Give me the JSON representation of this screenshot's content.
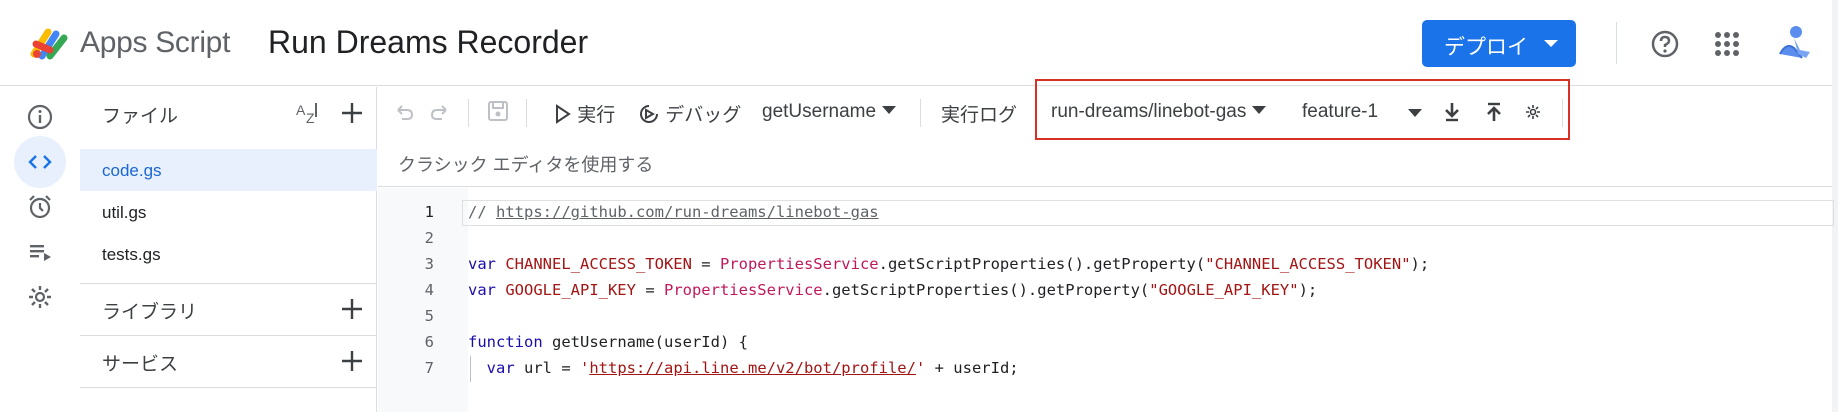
{
  "header": {
    "brand": "Apps Script",
    "project_title": "Run Dreams Recorder",
    "deploy_label": "デプロイ"
  },
  "files_panel": {
    "title": "ファイル",
    "files": [
      {
        "name": "code.gs",
        "selected": true
      },
      {
        "name": "util.gs",
        "selected": false
      },
      {
        "name": "tests.gs",
        "selected": false
      }
    ],
    "libraries_label": "ライブラリ",
    "services_label": "サービス"
  },
  "toolbar": {
    "run_label": "実行",
    "debug_label": "デバッグ",
    "function_select": "getUsername",
    "log_label": "実行ログ",
    "gas_repo": "run-dreams/linebot-gas",
    "gas_branch": "feature-1",
    "classic_editor_link": "クラシック エディタを使用する"
  },
  "editor": {
    "lines": [
      {
        "num": "1",
        "tokens": [
          {
            "t": "cmt",
            "v": "// "
          },
          {
            "t": "url",
            "v": "https://github.com/run-dreams/linebot-gas"
          }
        ]
      },
      {
        "num": "2",
        "tokens": []
      },
      {
        "num": "3",
        "tokens": [
          {
            "t": "kw",
            "v": "var "
          },
          {
            "t": "var",
            "v": "CHANNEL_ACCESS_TOKEN"
          },
          {
            "t": "fn",
            "v": " = "
          },
          {
            "t": "cls",
            "v": "PropertiesService"
          },
          {
            "t": "fn",
            "v": ".getScriptProperties().getProperty("
          },
          {
            "t": "str",
            "v": "\"CHANNEL_ACCESS_TOKEN\""
          },
          {
            "t": "fn",
            "v": ");"
          }
        ]
      },
      {
        "num": "4",
        "tokens": [
          {
            "t": "kw",
            "v": "var "
          },
          {
            "t": "var",
            "v": "GOOGLE_API_KEY"
          },
          {
            "t": "fn",
            "v": " = "
          },
          {
            "t": "cls",
            "v": "PropertiesService"
          },
          {
            "t": "fn",
            "v": ".getScriptProperties().getProperty("
          },
          {
            "t": "str",
            "v": "\"GOOGLE_API_KEY\""
          },
          {
            "t": "fn",
            "v": ");"
          }
        ]
      },
      {
        "num": "5",
        "tokens": []
      },
      {
        "num": "6",
        "tokens": [
          {
            "t": "kw",
            "v": "function "
          },
          {
            "t": "fn",
            "v": "getUsername(userId) {"
          }
        ]
      },
      {
        "num": "7",
        "tokens": [
          {
            "t": "fn",
            "v": "  "
          },
          {
            "t": "kw",
            "v": "var "
          },
          {
            "t": "fn",
            "v": "url = "
          },
          {
            "t": "str",
            "v": "'"
          },
          {
            "t": "strurl",
            "v": "https://api.line.me/v2/bot/profile/"
          },
          {
            "t": "str",
            "v": "'"
          },
          {
            "t": "fn",
            "v": " + userId;"
          }
        ]
      }
    ]
  },
  "colors": {
    "accent": "#1a73e8",
    "selected_bg": "#e8f0fe",
    "highlight_box": "#d93025"
  },
  "icons": [
    "apps-script-logo",
    "help-icon",
    "apps-grid-icon",
    "avatar",
    "info-icon",
    "code-icon",
    "alarm-icon",
    "executions-icon",
    "gear-icon",
    "sort-az-icon",
    "add-icon",
    "undo-icon",
    "redo-icon",
    "save-icon",
    "play-icon",
    "debug-icon",
    "caret-down-icon",
    "download-icon",
    "upload-icon",
    "settings-small-icon"
  ]
}
